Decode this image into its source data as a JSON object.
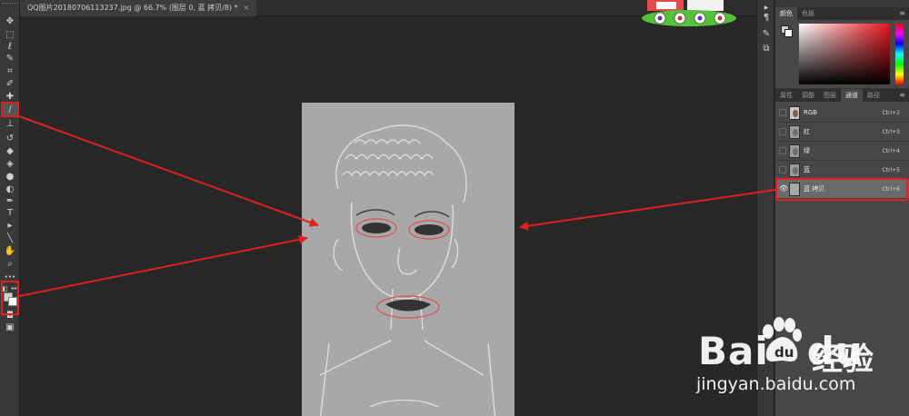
{
  "document": {
    "tab_title": "QQ图片20180706113237.jpg @ 66.7% (图层 0, 蓝 拷贝/8) *",
    "close_glyph": "×"
  },
  "toolbar": {
    "tools": [
      {
        "name": "move-tool-icon",
        "glyph": "✥"
      },
      {
        "name": "marquee-tool-icon",
        "glyph": "⬚"
      },
      {
        "name": "lasso-tool-icon",
        "glyph": "ℓ"
      },
      {
        "name": "quick-select-tool-icon",
        "glyph": "✎"
      },
      {
        "name": "crop-tool-icon",
        "glyph": "⌗"
      },
      {
        "name": "eyedropper-tool-icon",
        "glyph": "✐"
      },
      {
        "name": "healing-brush-tool-icon",
        "glyph": "✚"
      },
      {
        "name": "brush-tool-icon",
        "glyph": "/"
      },
      {
        "name": "clone-stamp-tool-icon",
        "glyph": "⊥"
      },
      {
        "name": "history-brush-tool-icon",
        "glyph": "↺"
      },
      {
        "name": "eraser-tool-icon",
        "glyph": "◆"
      },
      {
        "name": "paint-bucket-tool-icon",
        "glyph": "◈"
      },
      {
        "name": "blur-tool-icon",
        "glyph": "●"
      },
      {
        "name": "dodge-tool-icon",
        "glyph": "◐"
      },
      {
        "name": "pen-tool-icon",
        "glyph": "✒"
      },
      {
        "name": "type-tool-icon",
        "glyph": "T"
      },
      {
        "name": "path-select-tool-icon",
        "glyph": "▸"
      },
      {
        "name": "line-tool-icon",
        "glyph": "╲"
      },
      {
        "name": "hand-tool-icon",
        "glyph": "✋"
      },
      {
        "name": "zoom-tool-icon",
        "glyph": "⌕"
      },
      {
        "name": "more-tools-icon",
        "glyph": "•••"
      }
    ],
    "active_tool": "brush-tool-icon",
    "quickmask_glyph": "◘",
    "screenmode_glyph": "▣"
  },
  "side_icons": [
    "▶",
    "¶",
    "✎",
    "⧉"
  ],
  "color_panel": {
    "tabs": [
      "颜色",
      "色板"
    ],
    "active_tab": 0,
    "menu_glyph": "≡"
  },
  "channels_panel": {
    "tabs": [
      "属性",
      "调整",
      "图层",
      "通道",
      "路径"
    ],
    "active_tab": 3,
    "menu_glyph": "≡",
    "channels": [
      {
        "name": "RGB",
        "shortcut": "Ctrl+2",
        "visible": false,
        "selected": false,
        "thumb": "color"
      },
      {
        "name": "红",
        "shortcut": "Ctrl+3",
        "visible": false,
        "selected": false,
        "thumb": "gray"
      },
      {
        "name": "绿",
        "shortcut": "Ctrl+4",
        "visible": false,
        "selected": false,
        "thumb": "gray"
      },
      {
        "name": "蓝",
        "shortcut": "Ctrl+5",
        "visible": false,
        "selected": false,
        "thumb": "gray"
      },
      {
        "name": "蓝 拷贝",
        "shortcut": "Ctrl+6",
        "visible": true,
        "selected": true,
        "thumb": "flat"
      }
    ]
  },
  "watermark": {
    "brand": "Bai",
    "brand2": "du",
    "cn": "经验",
    "url": "jingyan.baidu.com"
  },
  "colors": {
    "highlight": "#e02020",
    "canvas_gray": "#a7a7a7"
  }
}
